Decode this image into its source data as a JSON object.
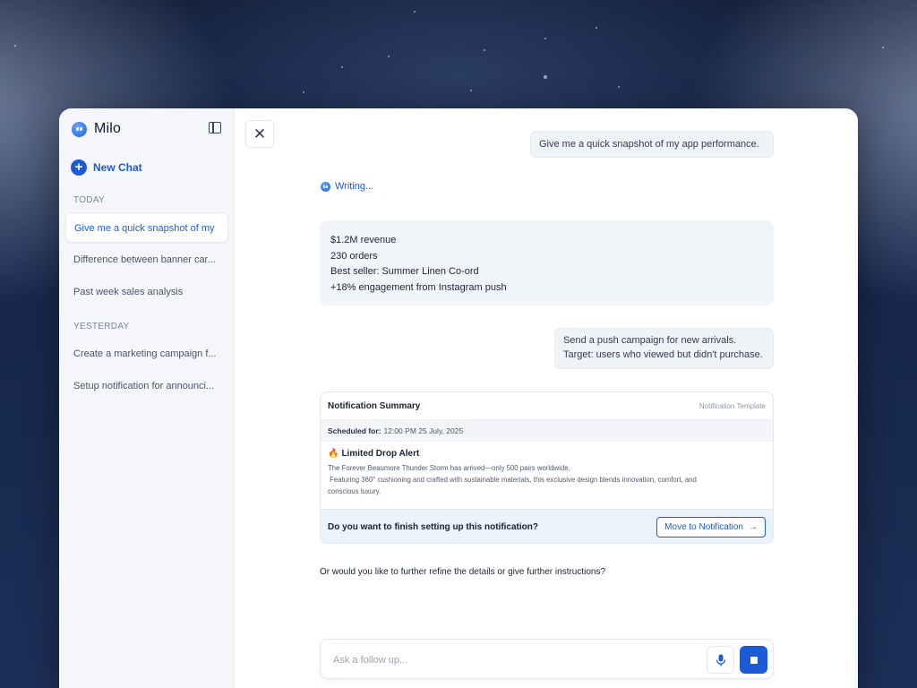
{
  "app": {
    "name": "Milo"
  },
  "sidebar": {
    "new_chat_label": "New Chat",
    "sections": [
      {
        "label": "TODAY",
        "items": [
          "Give me a quick snapshot of my",
          "Difference between banner car...",
          "Past week sales analysis"
        ]
      },
      {
        "label": "YESTERDAY",
        "items": [
          "Create a marketing campaign f...",
          "Setup notification for announci..."
        ]
      }
    ],
    "active_item": "Give me a quick snapshot of my"
  },
  "chat": {
    "user_message_1": "Give me a quick snapshot of my app performance.",
    "writing_label": "Writing...",
    "answer_lines": [
      "$1.2M revenue",
      "230 orders",
      "Best seller: Summer Linen Co-ord",
      "+18% engagement from Instagram push"
    ],
    "user_message_2_line1": "Send a push campaign for new arrivals.",
    "user_message_2_line2": "Target: users who viewed but didn't purchase.",
    "notification": {
      "title": "Notification Summary",
      "template_label": "Notification Template",
      "scheduled_label": "Scheduled for:",
      "scheduled_value": "12:00 PM 25 July, 2025",
      "alert_title": "Limited Drop Alert",
      "desc_line1": "The Forever Beaumore Thunder Storm has arrived—only 500 pairs worldwide.",
      "desc_line2": " Featuring 360° cushioning and crafted with sustainable materials, this exclusive design blends innovation, comfort, and",
      "desc_line3": "conscious luxury.",
      "question": "Do you want to finish setting up this notification?",
      "move_button": "Move to Notification"
    },
    "refine_text": "Or would you like to further refine the details or give further instructions?"
  },
  "input": {
    "placeholder": "Ask a follow up..."
  },
  "colors": {
    "accent": "#1d5bd6",
    "background_dark": "#16264a"
  }
}
